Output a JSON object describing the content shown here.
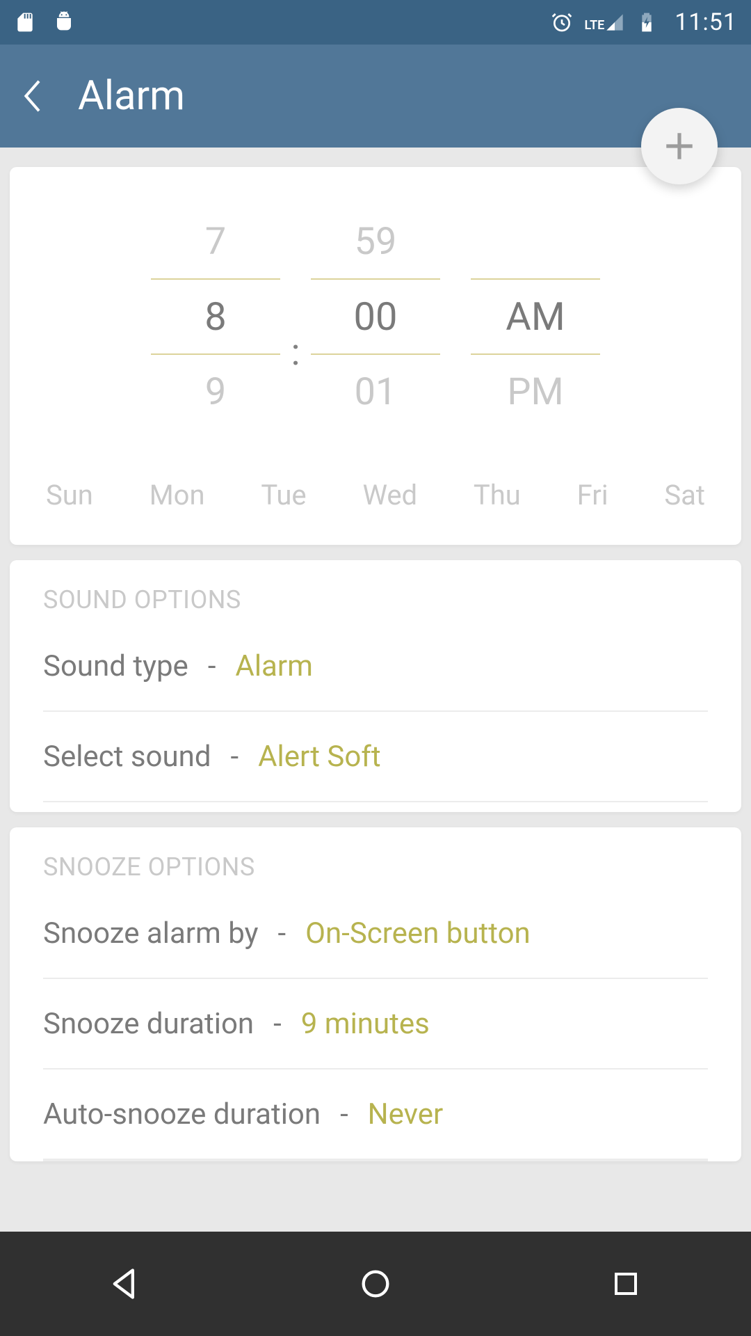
{
  "statusbar": {
    "clock": "11:51",
    "icons": [
      "sd-card-icon",
      "android-debug-icon",
      "alarm-icon",
      "lte-signal-icon",
      "battery-charging-icon"
    ]
  },
  "appbar": {
    "title": "Alarm"
  },
  "time_picker": {
    "hour": {
      "prev": "7",
      "selected": "8",
      "next": "9"
    },
    "minute": {
      "prev": "59",
      "selected": "00",
      "next": "01"
    },
    "ampm": {
      "selected": "AM",
      "next": "PM"
    },
    "separator": ":"
  },
  "days": [
    "Sun",
    "Mon",
    "Tue",
    "Wed",
    "Thu",
    "Fri",
    "Sat"
  ],
  "sound_options": {
    "title": "SOUND OPTIONS",
    "rows": [
      {
        "label": "Sound type",
        "value": "Alarm"
      },
      {
        "label": "Select sound",
        "value": "Alert Soft"
      }
    ]
  },
  "snooze_options": {
    "title": "SNOOZE OPTIONS",
    "rows": [
      {
        "label": "Snooze alarm by",
        "value": "On-Screen button"
      },
      {
        "label": "Snooze duration",
        "value": "9 minutes"
      },
      {
        "label": "Auto-snooze duration",
        "value": "Never"
      }
    ]
  },
  "dash": "-"
}
